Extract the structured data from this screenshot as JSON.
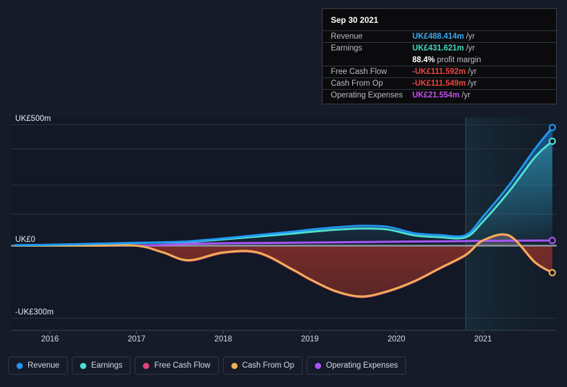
{
  "chart_data": {
    "type": "area",
    "title": "",
    "xlabel": "",
    "ylabel": "",
    "currency": "UK£",
    "unit": "m",
    "x_tick_labels": [
      "2016",
      "2017",
      "2018",
      "2019",
      "2020",
      "2021"
    ],
    "x_tick_values": [
      2016,
      2017,
      2018,
      2019,
      2020,
      2021
    ],
    "y_tick_labels": [
      "UK£500m",
      "UK£0",
      "-UK£300m"
    ],
    "y_tick_values": [
      500,
      0,
      -300
    ],
    "ylim": [
      -350,
      530
    ],
    "xlim": [
      2015.55,
      2021.85
    ],
    "grid": true,
    "legend_position": "bottom-left",
    "forecast_divider_x": 2020.8,
    "series": [
      {
        "name": "Revenue",
        "color": "#2196f3",
        "x": [
          2015.6,
          2016.0,
          2016.5,
          2017.0,
          2017.3,
          2017.6,
          2018.0,
          2018.4,
          2018.8,
          2019.0,
          2019.3,
          2019.6,
          2019.9,
          2020.2,
          2020.5,
          2020.8,
          2021.0,
          2021.3,
          2021.6,
          2021.8
        ],
        "y": [
          2,
          4,
          8,
          12,
          14,
          18,
          30,
          44,
          58,
          66,
          76,
          82,
          78,
          52,
          44,
          44,
          120,
          250,
          400,
          488.414
        ]
      },
      {
        "name": "Earnings",
        "color": "#4edfd0",
        "x": [
          2015.6,
          2016.0,
          2016.5,
          2017.0,
          2017.3,
          2017.6,
          2018.0,
          2018.4,
          2018.8,
          2019.0,
          2019.3,
          2019.6,
          2019.9,
          2020.2,
          2020.5,
          2020.8,
          2021.0,
          2021.3,
          2021.6,
          2021.8
        ],
        "y": [
          1,
          3,
          7,
          11,
          13,
          16,
          26,
          38,
          50,
          57,
          66,
          71,
          67,
          43,
          35,
          35,
          100,
          224,
          366,
          431.621
        ]
      },
      {
        "name": "Free Cash Flow",
        "color": "#e0457b",
        "x": [
          2015.6,
          2016.0,
          2016.5,
          2017.0,
          2017.3,
          2017.6,
          2018.0,
          2018.4,
          2018.8,
          2019.0,
          2019.3,
          2019.6,
          2019.9,
          2020.2,
          2020.5,
          2020.8,
          2021.0,
          2021.3,
          2021.6,
          2021.8
        ],
        "y": [
          0,
          0,
          0,
          0,
          -28,
          -62,
          -30,
          -30,
          -100,
          -140,
          -190,
          -212,
          -190,
          -150,
          -95,
          -40,
          20,
          40,
          -70,
          -111.592
        ]
      },
      {
        "name": "Cash From Op",
        "color": "#f0ae55",
        "x": [
          2015.6,
          2016.0,
          2016.5,
          2017.0,
          2017.3,
          2017.6,
          2018.0,
          2018.4,
          2018.8,
          2019.0,
          2019.3,
          2019.6,
          2019.9,
          2020.2,
          2020.5,
          2020.8,
          2021.0,
          2021.3,
          2021.6,
          2021.8
        ],
        "y": [
          0,
          0,
          0,
          0,
          -27,
          -60,
          -28,
          -28,
          -98,
          -138,
          -188,
          -210,
          -188,
          -148,
          -93,
          -38,
          22,
          42,
          -68,
          -111.549
        ]
      },
      {
        "name": "Operating Expenses",
        "color": "#a855f7",
        "x": [
          2015.6,
          2016.0,
          2016.5,
          2017.0,
          2017.3,
          2017.6,
          2018.0,
          2018.4,
          2018.8,
          2019.0,
          2019.3,
          2019.6,
          2019.9,
          2020.2,
          2020.5,
          2020.8,
          2021.0,
          2021.3,
          2021.6,
          2021.8
        ],
        "y": [
          0,
          0,
          0,
          1,
          3,
          8,
          10,
          11,
          12,
          13,
          14,
          15,
          16,
          17,
          18,
          19,
          20,
          20.6,
          21.2,
          21.554
        ]
      }
    ]
  },
  "tooltip": {
    "date": "Sep 30 2021",
    "rows": [
      {
        "label": "Revenue",
        "value": "UK£488.414m",
        "unit": "/yr",
        "color": "#3ba7f0"
      },
      {
        "label": "Earnings",
        "value": "UK£431.621m",
        "unit": "/yr",
        "color": "#3fd9bd"
      },
      {
        "label": "",
        "value": "88.4%",
        "unit": "profit margin",
        "color": "#ffffff"
      },
      {
        "label": "Free Cash Flow",
        "value": "-UK£111.592m",
        "unit": "/yr",
        "color": "#f0433c"
      },
      {
        "label": "Cash From Op",
        "value": "-UK£111.549m",
        "unit": "/yr",
        "color": "#f0433c"
      },
      {
        "label": "Operating Expenses",
        "value": "UK£21.554m",
        "unit": "/yr",
        "color": "#c44ff0"
      }
    ]
  },
  "legend": {
    "items": [
      {
        "label": "Revenue",
        "color": "#2196f3"
      },
      {
        "label": "Earnings",
        "color": "#4edfd0"
      },
      {
        "label": "Free Cash Flow",
        "color": "#e0457b"
      },
      {
        "label": "Cash From Op",
        "color": "#f0ae55"
      },
      {
        "label": "Operating Expenses",
        "color": "#a855f7"
      }
    ]
  },
  "axis": {
    "y_labels": [
      {
        "text": "UK£500m",
        "value": 500
      },
      {
        "text": "UK£0",
        "value": 0
      },
      {
        "text": "-UK£300m",
        "value": -300
      }
    ],
    "x_labels": [
      "2016",
      "2017",
      "2018",
      "2019",
      "2020",
      "2021"
    ]
  },
  "theme": {
    "background": "#151b28",
    "plot_background": "#121826",
    "forecast_background": "#12202c",
    "grid_color": "#2a3344"
  }
}
